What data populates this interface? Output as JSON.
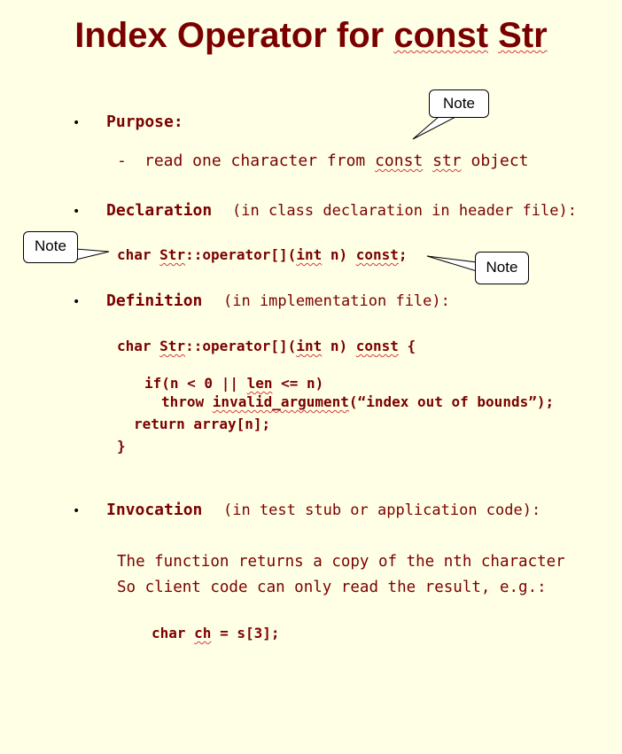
{
  "title": {
    "prefix": "Index Operator for ",
    "kw1": "const",
    "sp": " ",
    "kw2": "Str"
  },
  "notes": {
    "note1": "Note",
    "note2": "Note",
    "note3": "Note"
  },
  "purpose": {
    "heading": "Purpose:",
    "dash": "-",
    "line_pre": "read one character from ",
    "kw1": "const",
    "sp": " ",
    "kw2": "str",
    "line_post": " object"
  },
  "declaration": {
    "heading": "Declaration",
    "paren": "(in class declaration in header file):",
    "code_a": "char ",
    "code_b": "Str",
    "code_c": "::operator[](",
    "code_d": "int",
    "code_e": " n) ",
    "code_f": "const",
    "code_g": ";"
  },
  "definition": {
    "heading": "Definition",
    "paren": "(in implementation file):",
    "l1_a": "char ",
    "l1_b": "Str",
    "l1_c": "::operator[](",
    "l1_d": "int",
    "l1_e": " n) ",
    "l1_f": "const",
    "l1_g": " {",
    "l2_a": "if(n < 0 || ",
    "l2_b": "len",
    "l2_c": " <= n)",
    "l3_a": "throw ",
    "l3_b": "invalid_argument",
    "l3_c": "(“index out of bounds”);",
    "l4": "return array[n];",
    "l5": "}"
  },
  "invocation": {
    "heading": "Invocation",
    "paren": "(in test stub or application code):",
    "line1": "The function returns a copy of the nth character",
    "line2": "So client code can only read the result, e.g.:",
    "code_a": "char ",
    "code_b": "ch",
    "code_c": " = s[3];"
  },
  "bullet_char": "•"
}
